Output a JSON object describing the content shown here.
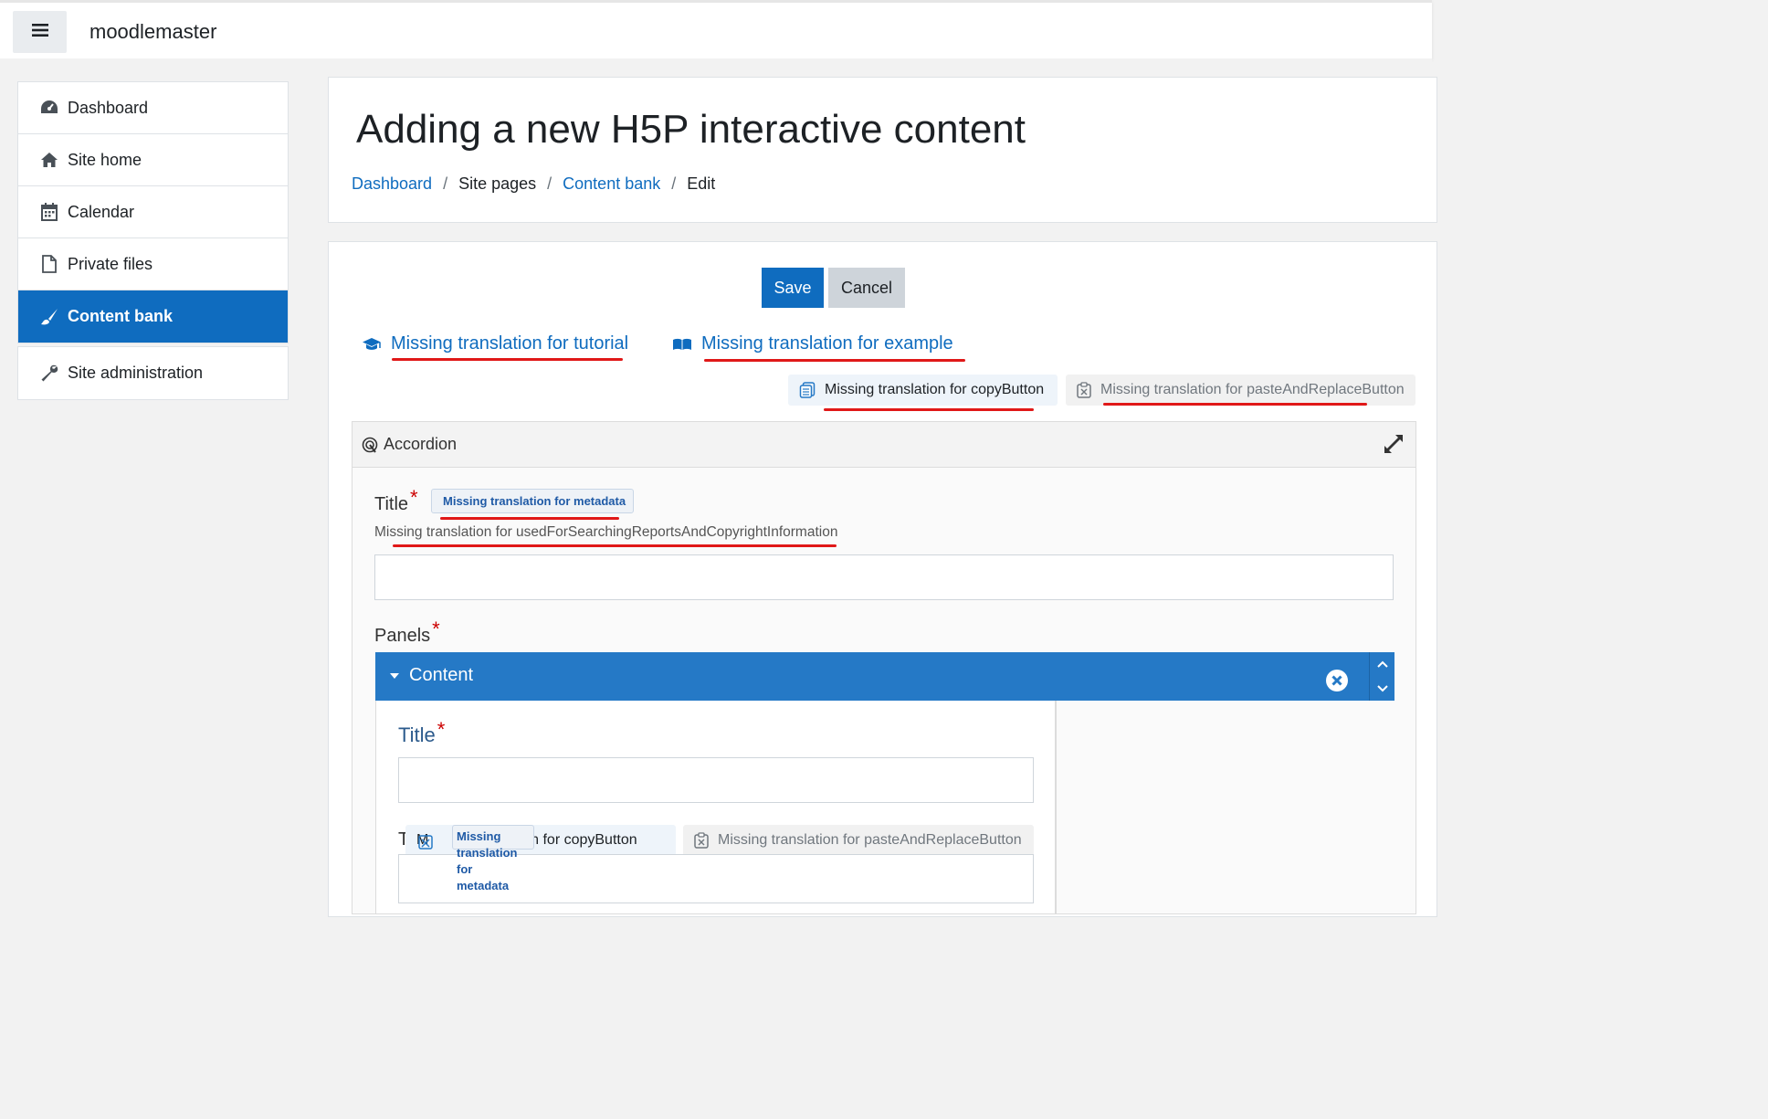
{
  "topbar": {
    "site_name": "moodlemaster"
  },
  "sidebar": {
    "items": [
      {
        "label": "Dashboard",
        "icon": "dashboard-icon"
      },
      {
        "label": "Site home",
        "icon": "home-icon"
      },
      {
        "label": "Calendar",
        "icon": "calendar-icon"
      },
      {
        "label": "Private files",
        "icon": "file-icon"
      },
      {
        "label": "Content bank",
        "icon": "paintbrush-icon",
        "active": true
      }
    ],
    "admin": {
      "label": "Site administration",
      "icon": "wrench-icon"
    }
  },
  "header": {
    "title": "Adding a new H5P interactive content",
    "breadcrumb": [
      "Dashboard",
      "Site pages",
      "Content bank",
      "Edit"
    ]
  },
  "form": {
    "save_label": "Save",
    "cancel_label": "Cancel",
    "tutorial_link": "Missing translation for tutorial",
    "example_link": "Missing translation for example",
    "copy_button": "Missing translation for copyButton",
    "paste_button": "Missing translation for pasteAndReplaceButton"
  },
  "editor": {
    "library_title": "Accordion",
    "title_label": "Title",
    "metadata_tag": "Missing translation for metadata",
    "title_description": "Missing translation for usedForSearchingReportsAndCopyrightInformation",
    "panels_label": "Panels",
    "panel": {
      "title": "Content",
      "title_label": "Title",
      "text_label": "Text",
      "copy_button_partial": "M",
      "copy_button_tail": "ation for copyButton",
      "paste_button": "Missing translation for pasteAndReplaceButton",
      "metadata_tag_lines": [
        "Missing",
        "translation",
        "for",
        "metadata"
      ]
    }
  },
  "colors": {
    "brand": "#0f6cbf",
    "panel_bar": "#2579c6",
    "annotation": "#e01818"
  }
}
